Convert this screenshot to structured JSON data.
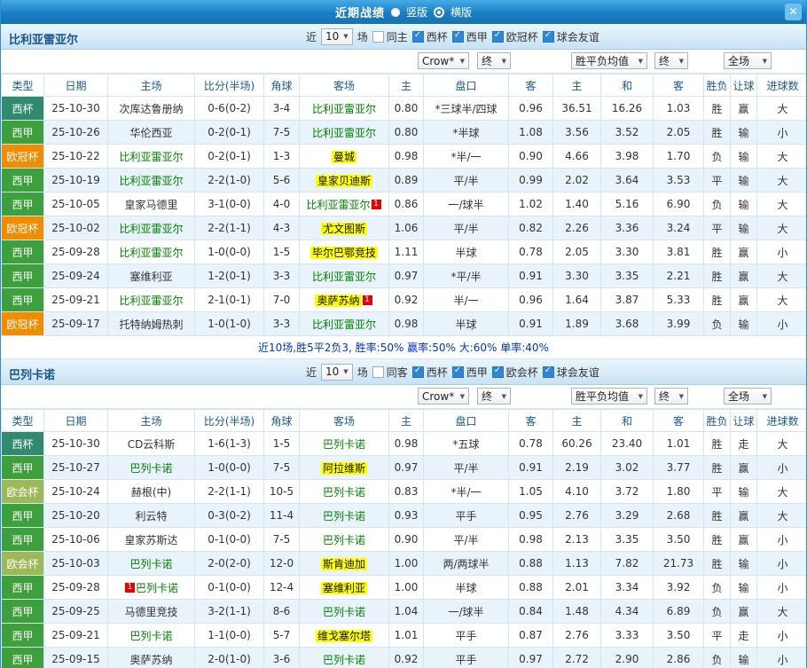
{
  "topbar": {
    "title": "近期战绩",
    "vertical_label": "竖版",
    "horizontal_label": "横版",
    "selected_layout": "横版"
  },
  "icons": {
    "chevron_down": "▼",
    "close": "✕",
    "check": "✓"
  },
  "colors": {
    "accent_blue": "#1672b3",
    "result_win_red": "#e60000",
    "result_lose_green": "#008000",
    "result_draw_blue": "#0000dd",
    "highlight_yellow": "#ffff00",
    "type_cup": "#2f8a6e",
    "type_liga": "#3da03d",
    "type_ucl": "#ef8c00",
    "type_uecl": "#9cb857"
  },
  "filter_bar": {
    "near": "近",
    "games": "10",
    "games_suffix": "场"
  },
  "dropdowns": {
    "company": "Crow*",
    "final1": "终",
    "avg": "胜平负均值",
    "final2": "终",
    "scope": "全场"
  },
  "table_headers": [
    "类型",
    "日期",
    "主场",
    "比分(半场)",
    "角球",
    "客场",
    "主",
    "盘口",
    "客",
    "主",
    "和",
    "客",
    "胜负",
    "让球",
    "进球数"
  ],
  "sections": [
    {
      "team": "比利亚雷亚尔",
      "checks": [
        {
          "label": "同主",
          "on": false
        },
        {
          "label": "西杯",
          "on": true
        },
        {
          "label": "西甲",
          "on": true
        },
        {
          "label": "欧冠杯",
          "on": true
        },
        {
          "label": "球会友谊",
          "on": true
        }
      ],
      "summary": "近10场,胜5平2负3, 胜率:50% 赢率:50% 大:60% 单率:40%",
      "rows": [
        {
          "t": "西杯",
          "tc": "t-cup",
          "d": "25-10-30",
          "h": "次库达鲁册纳",
          "hs": "opp",
          "hb": "",
          "a": "比利亚雷亚尔",
          "as": "focal",
          "ab": "",
          "sc": "0-6(0-2)",
          "co": "3-4",
          "o1": "0.80",
          "hc": "*三球半/四球",
          "hr": true,
          "o2": "0.96",
          "m1": "36.51",
          "m2": "16.26",
          "m3": "1.03",
          "r": "胜",
          "rc": "cr",
          "l": "赢",
          "lc": "cr",
          "g": "大",
          "gc": "cr"
        },
        {
          "t": "西甲",
          "tc": "t-liga",
          "d": "25-10-26",
          "h": "华伦西亚",
          "hs": "opp",
          "hb": "",
          "a": "比利亚雷亚尔",
          "as": "focal",
          "ab": "",
          "sc": "0-2(0-1)",
          "co": "7-5",
          "o1": "0.80",
          "hc": "*半球",
          "hr": true,
          "o2": "1.08",
          "m1": "3.56",
          "m2": "3.52",
          "m3": "2.05",
          "r": "胜",
          "rc": "cr",
          "l": "输",
          "lc": "cg",
          "g": "小",
          "gc": "cg"
        },
        {
          "t": "欧冠杯",
          "tc": "t-ucl",
          "d": "25-10-22",
          "h": "比利亚雷亚尔",
          "hs": "focal",
          "hb": "",
          "a": "曼城",
          "as": "oppy",
          "ab": "",
          "sc": "0-2(0-1)",
          "co": "1-3",
          "o1": "0.98",
          "hc": "*半/一",
          "hr": true,
          "o2": "0.90",
          "m1": "4.66",
          "m2": "3.98",
          "m3": "1.70",
          "r": "负",
          "rc": "cg",
          "l": "输",
          "lc": "cg",
          "g": "大",
          "gc": "cr"
        },
        {
          "t": "西甲",
          "tc": "t-liga",
          "d": "25-10-19",
          "h": "比利亚雷亚尔",
          "hs": "focal",
          "hb": "",
          "a": "皇家贝迪斯",
          "as": "oppy",
          "ab": "",
          "sc": "2-2(1-0)",
          "co": "5-6",
          "o1": "0.89",
          "hc": "平/半",
          "hr": false,
          "o2": "0.99",
          "m1": "2.02",
          "m2": "3.64",
          "m3": "3.53",
          "r": "平",
          "rc": "cbl",
          "l": "输",
          "lc": "cg",
          "g": "大",
          "gc": "cr"
        },
        {
          "t": "西甲",
          "tc": "t-liga",
          "d": "25-10-05",
          "h": "皇家马德里",
          "hs": "opp",
          "hb": "",
          "a": "比利亚雷亚尔",
          "as": "focal",
          "ab": "1",
          "sc": "3-1(0-0)",
          "co": "4-0",
          "o1": "0.86",
          "hc": "一/球半",
          "hr": false,
          "o2": "1.02",
          "m1": "1.40",
          "m2": "5.16",
          "m3": "6.90",
          "r": "负",
          "rc": "cg",
          "l": "输",
          "lc": "cg",
          "g": "大",
          "gc": "cr"
        },
        {
          "t": "欧冠杯",
          "tc": "t-ucl",
          "d": "25-10-02",
          "h": "比利亚雷亚尔",
          "hs": "focal",
          "hb": "",
          "a": "尤文图斯",
          "as": "oppy",
          "ab": "",
          "sc": "2-2(1-1)",
          "co": "4-3",
          "o1": "1.06",
          "hc": "平/半",
          "hr": false,
          "o2": "0.82",
          "m1": "2.26",
          "m2": "3.36",
          "m3": "3.24",
          "r": "平",
          "rc": "cbl",
          "l": "输",
          "lc": "cg",
          "g": "大",
          "gc": "cr"
        },
        {
          "t": "西甲",
          "tc": "t-liga",
          "d": "25-09-28",
          "h": "比利亚雷亚尔",
          "hs": "focal",
          "hb": "",
          "a": "毕尔巴鄂竞技",
          "as": "oppy",
          "ab": "",
          "sc": "1-0(0-0)",
          "co": "1-5",
          "o1": "1.11",
          "hc": "半球",
          "hr": false,
          "o2": "0.78",
          "m1": "2.05",
          "m2": "3.30",
          "m3": "3.81",
          "r": "胜",
          "rc": "cr",
          "l": "赢",
          "lc": "cr",
          "g": "小",
          "gc": "cg"
        },
        {
          "t": "西甲",
          "tc": "t-liga",
          "d": "25-09-24",
          "h": "塞维利亚",
          "hs": "opp",
          "hb": "",
          "a": "比利亚雷亚尔",
          "as": "focal",
          "ab": "",
          "sc": "1-2(0-1)",
          "co": "3-3",
          "o1": "0.97",
          "hc": "*平/半",
          "hr": true,
          "o2": "0.91",
          "m1": "3.30",
          "m2": "3.35",
          "m3": "2.21",
          "r": "胜",
          "rc": "cr",
          "l": "赢",
          "lc": "cr",
          "g": "大",
          "gc": "cr"
        },
        {
          "t": "西甲",
          "tc": "t-liga",
          "d": "25-09-21",
          "h": "比利亚雷亚尔",
          "hs": "focal",
          "hb": "",
          "a": "奥萨苏纳",
          "as": "oppy",
          "ab": "1",
          "sc": "2-1(0-1)",
          "co": "7-0",
          "o1": "0.92",
          "hc": "半/一",
          "hr": false,
          "o2": "0.96",
          "m1": "1.64",
          "m2": "3.87",
          "m3": "5.33",
          "r": "胜",
          "rc": "cr",
          "l": "赢",
          "lc": "cr",
          "g": "大",
          "gc": "cr"
        },
        {
          "t": "欧冠杯",
          "tc": "t-ucl",
          "d": "25-09-17",
          "h": "托特纳姆热刺",
          "hs": "opp",
          "hb": "",
          "a": "比利亚雷亚尔",
          "as": "focal",
          "ab": "",
          "sc": "1-0(1-0)",
          "co": "3-3",
          "o1": "0.98",
          "hc": "半球",
          "hr": false,
          "o2": "0.91",
          "m1": "1.89",
          "m2": "3.68",
          "m3": "3.99",
          "r": "负",
          "rc": "cg",
          "l": "输",
          "lc": "cg",
          "g": "小",
          "gc": "cg"
        }
      ]
    },
    {
      "team": "巴列卡诺",
      "checks": [
        {
          "label": "同客",
          "on": false
        },
        {
          "label": "西杯",
          "on": true
        },
        {
          "label": "西甲",
          "on": true
        },
        {
          "label": "欧会杯",
          "on": true
        },
        {
          "label": "球会友谊",
          "on": true
        }
      ],
      "summary": "",
      "rows": [
        {
          "t": "西杯",
          "tc": "t-cup",
          "d": "25-10-30",
          "h": "CD云科斯",
          "hs": "opp",
          "hb": "",
          "a": "巴列卡诺",
          "as": "focal",
          "ab": "",
          "sc": "1-6(1-3)",
          "co": "1-5",
          "o1": "0.98",
          "hc": "*五球",
          "hr": true,
          "o2": "0.78",
          "m1": "60.26",
          "m2": "23.40",
          "m3": "1.01",
          "r": "胜",
          "rc": "cr",
          "l": "走",
          "lc": "cbl",
          "g": "大",
          "gc": "cr"
        },
        {
          "t": "西甲",
          "tc": "t-liga",
          "d": "25-10-27",
          "h": "巴列卡诺",
          "hs": "focal",
          "hb": "",
          "a": "阿拉维斯",
          "as": "oppy",
          "ab": "",
          "sc": "1-0(0-0)",
          "co": "7-5",
          "o1": "0.97",
          "hc": "平/半",
          "hr": false,
          "o2": "0.91",
          "m1": "2.19",
          "m2": "3.02",
          "m3": "3.77",
          "r": "胜",
          "rc": "cr",
          "l": "赢",
          "lc": "cr",
          "g": "小",
          "gc": "cg"
        },
        {
          "t": "欧会杯",
          "tc": "t-uecl",
          "d": "25-10-24",
          "h": "赫根(中)",
          "hs": "opp",
          "hb": "",
          "a": "巴列卡诺",
          "as": "focal",
          "ab": "",
          "sc": "2-2(1-1)",
          "co": "10-5",
          "o1": "0.83",
          "hc": "*半/一",
          "hr": true,
          "o2": "1.05",
          "m1": "4.10",
          "m2": "3.72",
          "m3": "1.80",
          "r": "平",
          "rc": "cbl",
          "l": "输",
          "lc": "cg",
          "g": "大",
          "gc": "cr"
        },
        {
          "t": "西甲",
          "tc": "t-liga",
          "d": "25-10-20",
          "h": "利云特",
          "hs": "opp",
          "hb": "",
          "a": "巴列卡诺",
          "as": "focal",
          "ab": "",
          "sc": "0-3(0-2)",
          "co": "11-4",
          "o1": "0.93",
          "hc": "平手",
          "hr": false,
          "o2": "0.95",
          "m1": "2.76",
          "m2": "3.29",
          "m3": "2.68",
          "r": "胜",
          "rc": "cr",
          "l": "赢",
          "lc": "cr",
          "g": "大",
          "gc": "cr"
        },
        {
          "t": "西甲",
          "tc": "t-liga",
          "d": "25-10-06",
          "h": "皇家苏斯达",
          "hs": "opp",
          "hb": "",
          "a": "巴列卡诺",
          "as": "focal",
          "ab": "",
          "sc": "0-1(0-0)",
          "co": "7-5",
          "o1": "0.90",
          "hc": "平/半",
          "hr": false,
          "o2": "0.98",
          "m1": "2.13",
          "m2": "3.35",
          "m3": "3.50",
          "r": "胜",
          "rc": "cr",
          "l": "赢",
          "lc": "cr",
          "g": "小",
          "gc": "cg"
        },
        {
          "t": "欧会杯",
          "tc": "t-uecl",
          "d": "25-10-03",
          "h": "巴列卡诺",
          "hs": "focal",
          "hb": "",
          "a": "斯肯迪加",
          "as": "oppy",
          "ab": "",
          "sc": "2-0(2-0)",
          "co": "12-0",
          "o1": "1.00",
          "hc": "两/两球半",
          "hr": false,
          "o2": "0.88",
          "m1": "1.13",
          "m2": "7.82",
          "m3": "21.73",
          "r": "胜",
          "rc": "cr",
          "l": "输",
          "lc": "cg",
          "g": "小",
          "gc": "cg"
        },
        {
          "t": "西甲",
          "tc": "t-liga",
          "d": "25-09-28",
          "h": "巴列卡诺",
          "hs": "focal",
          "hb": "1",
          "hbb": true,
          "a": "塞维利亚",
          "as": "oppy",
          "ab": "",
          "sc": "0-1(0-0)",
          "co": "12-4",
          "o1": "1.00",
          "hc": "半球",
          "hr": false,
          "o2": "0.88",
          "m1": "2.01",
          "m2": "3.34",
          "m3": "3.92",
          "r": "负",
          "rc": "cg",
          "l": "输",
          "lc": "cg",
          "g": "小",
          "gc": "cg"
        },
        {
          "t": "西甲",
          "tc": "t-liga",
          "d": "25-09-25",
          "h": "马德里竞技",
          "hs": "opp",
          "hb": "",
          "a": "巴列卡诺",
          "as": "focal",
          "ab": "",
          "sc": "3-2(1-1)",
          "co": "8-6",
          "o1": "1.04",
          "hc": "一/球半",
          "hr": false,
          "o2": "0.84",
          "m1": "1.48",
          "m2": "4.34",
          "m3": "6.89",
          "r": "负",
          "rc": "cg",
          "l": "赢",
          "lc": "cr",
          "g": "大",
          "gc": "cr"
        },
        {
          "t": "西甲",
          "tc": "t-liga",
          "d": "25-09-21",
          "h": "巴列卡诺",
          "hs": "focal",
          "hb": "",
          "a": "维戈塞尔塔",
          "as": "oppy",
          "ab": "",
          "sc": "1-1(0-0)",
          "co": "5-7",
          "o1": "1.01",
          "hc": "平手",
          "hr": false,
          "o2": "0.87",
          "m1": "2.76",
          "m2": "3.33",
          "m3": "3.50",
          "r": "平",
          "rc": "cbl",
          "l": "走",
          "lc": "cbl",
          "g": "小",
          "gc": "cg"
        },
        {
          "t": "西甲",
          "tc": "t-liga",
          "d": "25-09-15",
          "h": "奥萨苏纳",
          "hs": "opp",
          "hb": "",
          "a": "巴列卡诺",
          "as": "focal",
          "ab": "",
          "sc": "2-0(1-0)",
          "co": "3-6",
          "o1": "0.92",
          "hc": "平手",
          "hr": false,
          "o2": "0.97",
          "m1": "2.72",
          "m2": "2.90",
          "m3": "2.86",
          "r": "负",
          "rc": "cg",
          "l": "输",
          "lc": "cg",
          "g": "小",
          "gc": "cg"
        }
      ]
    }
  ]
}
